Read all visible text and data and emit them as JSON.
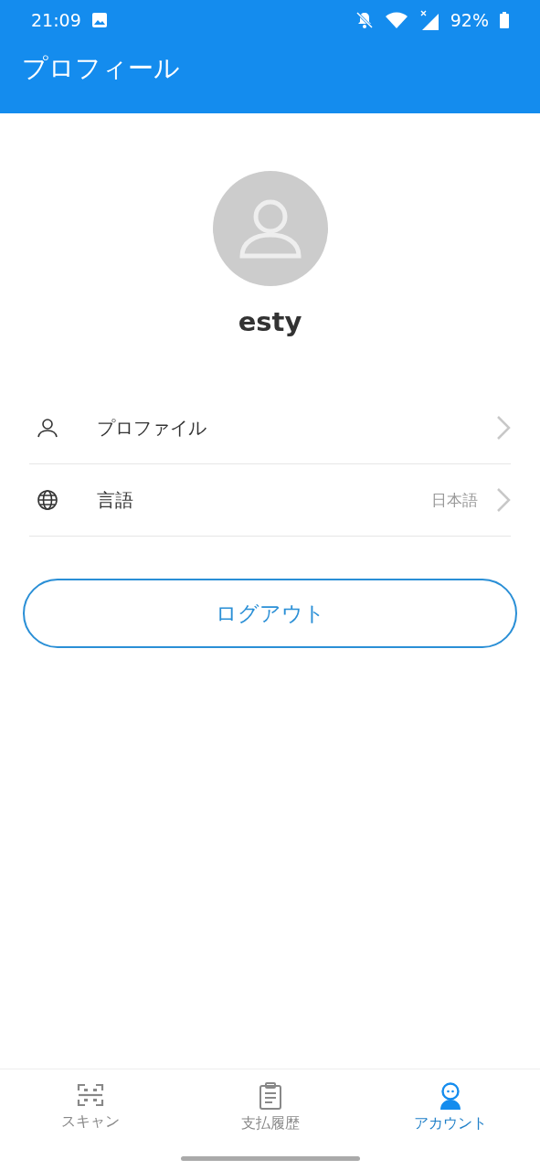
{
  "status_bar": {
    "time": "21:09",
    "battery": "92%"
  },
  "header": {
    "title": "プロフィール"
  },
  "user": {
    "name": "esty"
  },
  "menu": [
    {
      "kind": "person",
      "label": "プロファイル"
    },
    {
      "kind": "globe",
      "label": "言語",
      "value": "日本語"
    }
  ],
  "logout_button": "ログアウト",
  "bottom_nav": [
    {
      "kind": "scan",
      "label": "スキャン",
      "selected": false
    },
    {
      "kind": "receipt",
      "label": "支払履歴",
      "selected": false
    },
    {
      "kind": "account",
      "label": "アカウント",
      "selected": true
    }
  ]
}
